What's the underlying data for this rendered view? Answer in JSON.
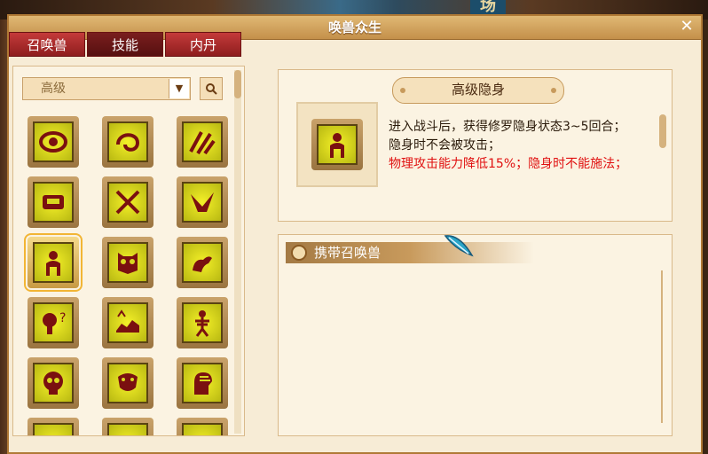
{
  "background": {
    "badge_text": "场"
  },
  "window": {
    "title": "唤兽众生",
    "close_label": "✕"
  },
  "tabs": [
    {
      "label": "召唤兽",
      "active": false
    },
    {
      "label": "技能",
      "active": true
    },
    {
      "label": "内丹",
      "active": false
    }
  ],
  "filter": {
    "selected": "高级",
    "dropdown_icon": "chevron-down-icon",
    "search_icon": "search-icon"
  },
  "skills": [
    {
      "icon": "eye-icon"
    },
    {
      "icon": "swirl-icon"
    },
    {
      "icon": "claw-icon"
    },
    {
      "icon": "shield-icon"
    },
    {
      "icon": "swords-icon"
    },
    {
      "icon": "bird-icon"
    },
    {
      "icon": "figure-icon",
      "selected": true
    },
    {
      "icon": "owl-icon"
    },
    {
      "icon": "arm-icon"
    },
    {
      "icon": "question-icon"
    },
    {
      "icon": "beast-icon"
    },
    {
      "icon": "skeleton-icon"
    },
    {
      "icon": "skull-icon"
    },
    {
      "icon": "serpent-icon"
    },
    {
      "icon": "head-icon"
    }
  ],
  "detail": {
    "skill_name": "高级隐身",
    "desc_black_1": "进入战斗后，获得修罗隐身状态3~5回合；",
    "desc_black_2": "隐身时不会被攻击；",
    "desc_red": "物理攻击能力降低15%；隐身时不能施法；"
  },
  "carry": {
    "title": "携带召唤兽"
  },
  "colors": {
    "accent_red": "#e01010",
    "frame_gold": "#b07a36"
  }
}
